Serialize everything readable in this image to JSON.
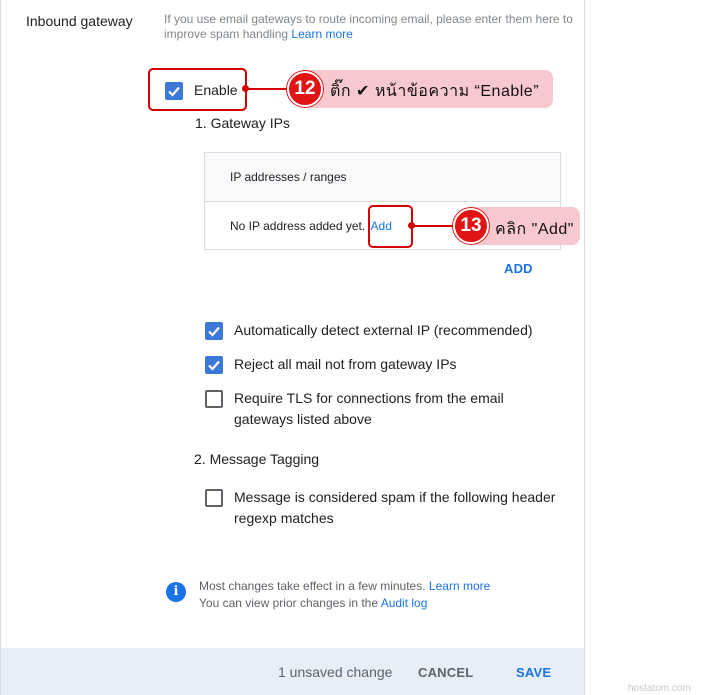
{
  "section": {
    "title": "Inbound gateway",
    "description": "If you use email gateways to route incoming email, please enter them here to improve spam handling",
    "learn_more": "Learn more"
  },
  "enable": {
    "label": "Enable",
    "checked": true
  },
  "gateway_ips": {
    "heading": "1. Gateway IPs",
    "table_header": "IP addresses / ranges",
    "empty_text": "No IP address added yet.",
    "add_link": "Add",
    "add_button": "ADD"
  },
  "options": {
    "auto_detect": {
      "label": "Automatically detect external IP (recommended)",
      "checked": true
    },
    "reject": {
      "label": "Reject all mail not from gateway IPs",
      "checked": true
    },
    "tls_line1": "Require TLS for connections from the email",
    "tls_line2": "gateways listed above",
    "tls_checked": false
  },
  "tagging": {
    "heading": "2. Message Tagging",
    "line1": "Message is considered spam if the following header",
    "line2": "regexp matches",
    "checked": false
  },
  "info": {
    "line1": "Most changes take effect in a few minutes.",
    "learn_more": "Learn more",
    "line2": "You can view prior changes in the",
    "audit_log": "Audit log"
  },
  "footer": {
    "unsaved": "1 unsaved change",
    "cancel": "CANCEL",
    "save": "SAVE"
  },
  "annotations": {
    "step12": {
      "number": "12",
      "text": "ติ๊ก  ✔ หน้าข้อความ “Enable”"
    },
    "step13": {
      "number": "13",
      "text": "คลิก \"Add\""
    }
  },
  "watermark": "hostatom.com",
  "colors": {
    "accent": "#1a73e8",
    "checkbox": "#3c78d8",
    "annotation": "#d50000",
    "callout_bg": "#f8c8cf",
    "footer_bg": "#e8eef9"
  }
}
